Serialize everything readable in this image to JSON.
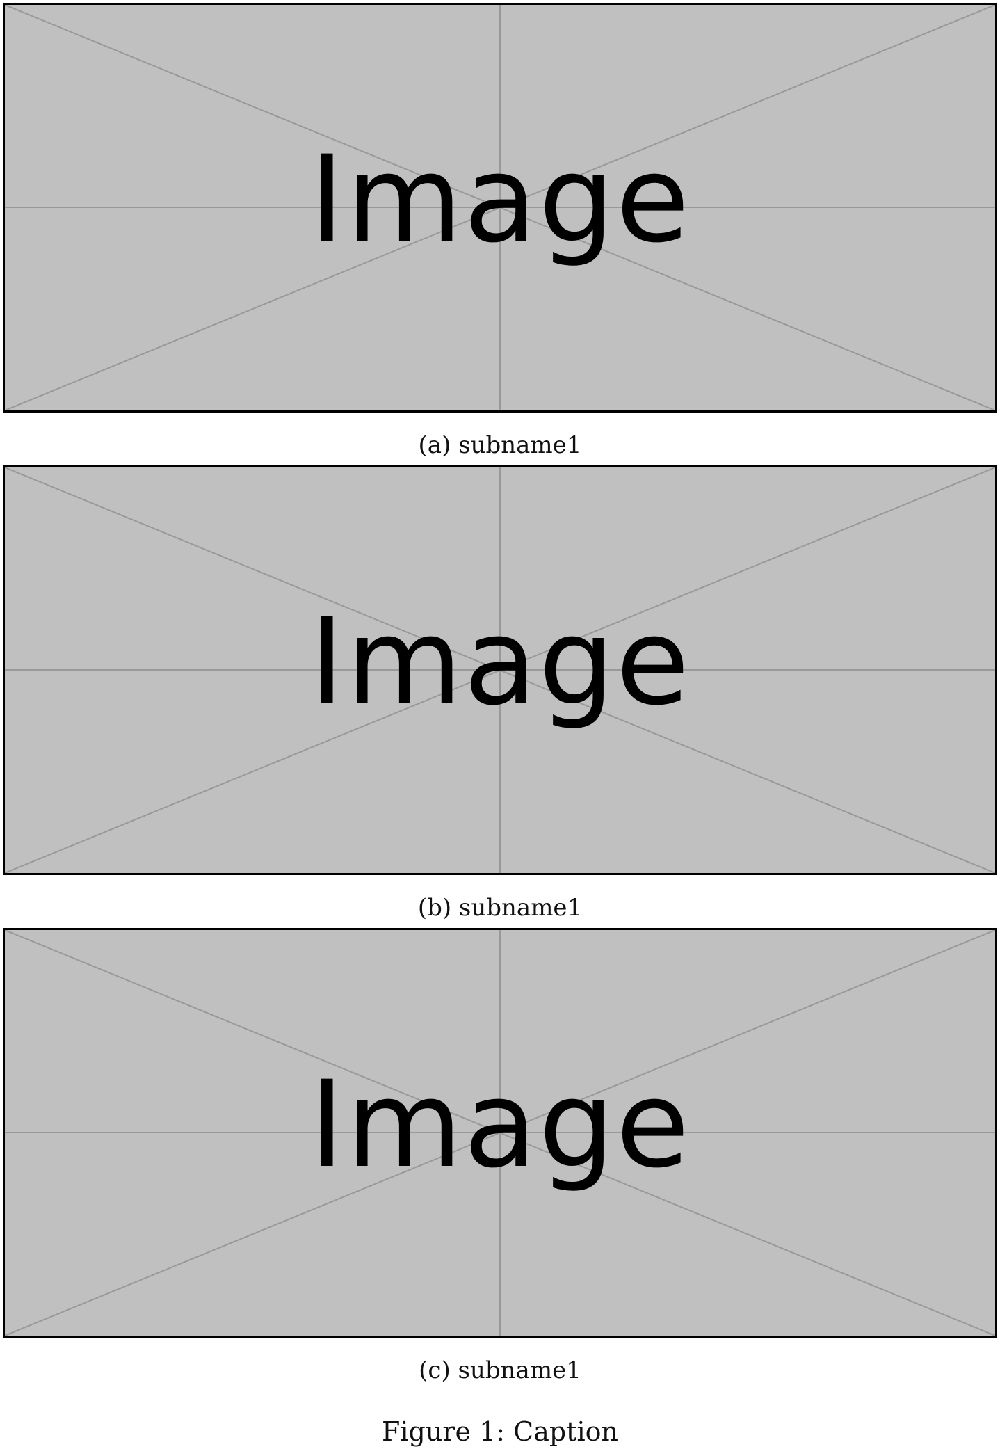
{
  "figure": {
    "caption": "Figure 1: Caption",
    "subfigures": [
      {
        "placeholder_text": "Image",
        "subcaption": "(a) subname1"
      },
      {
        "placeholder_text": "Image",
        "subcaption": "(b) subname1"
      },
      {
        "placeholder_text": "Image",
        "subcaption": "(c) subname1"
      }
    ]
  },
  "colors": {
    "placeholder_fill": "#c0c0c0",
    "placeholder_lines": "#999999",
    "border": "#000000"
  }
}
